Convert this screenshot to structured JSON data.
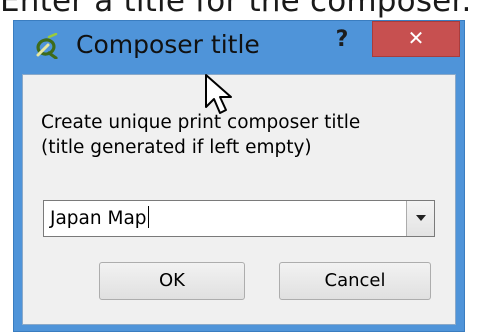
{
  "background": {
    "caption": "Enter a title for the composer. L"
  },
  "dialog": {
    "title": "Composer title",
    "help_label": "?",
    "close_label": "✕",
    "prompt_line1": "Create unique print composer title",
    "prompt_line2": "(title generated if left empty)",
    "title_value": "Japan Map",
    "ok_label": "OK",
    "cancel_label": "Cancel"
  },
  "icons": {
    "app": "qgis-icon",
    "cursor": "mouse-pointer-icon",
    "dropdown": "chevron-down-icon"
  },
  "colors": {
    "titlebar": "#4f94d9",
    "close_button": "#c75050",
    "client": "#f0f0f0"
  }
}
